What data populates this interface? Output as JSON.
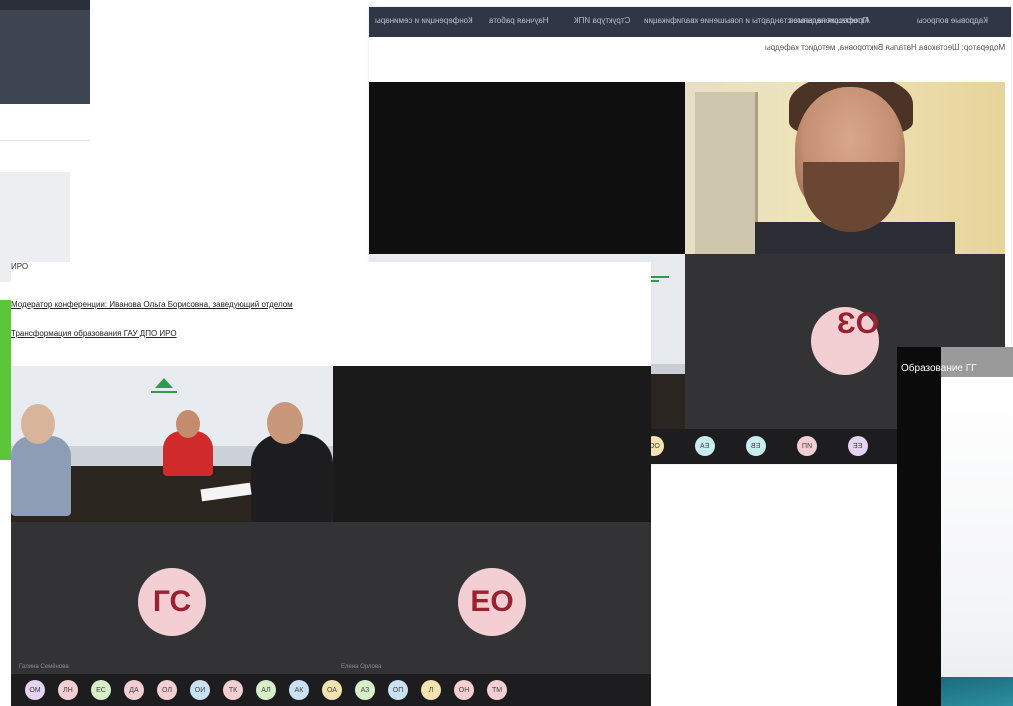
{
  "screenshot_b": {
    "nav_items": [
      "Кадровые вопросы",
      "Аттестация педагогов",
      "Профессиональные стандарты и повышение квалификации",
      "Структура ИПК",
      "Научная работа",
      "Конференции и семинары"
    ],
    "subtitle": "Модератор: Шестакова Наталья Викторовна, методист кафедры",
    "black_tile_name": "",
    "oz_initials": "ОЗ",
    "strip_participants": [
      {
        "initials": "СТ",
        "color": "#f3cfd4"
      },
      {
        "initials": "ОВ",
        "color": "#f3cfd4"
      },
      {
        "initials": "СВ",
        "color": "#f3cfd4"
      },
      {
        "initials": "Г",
        "color": "#f3e3b0"
      },
      {
        "initials": "АА",
        "color": "#d7f0c9"
      },
      {
        "initials": "ОО",
        "color": "#f3e3b0"
      },
      {
        "initials": "ЕА",
        "color": "#c9eef0"
      },
      {
        "initials": "ЕВ",
        "color": "#c9eef0"
      },
      {
        "initials": "ИП",
        "color": "#f3cfd4"
      },
      {
        "initials": "ЕЕ",
        "color": "#e5d3f2"
      },
      {
        "initials": "ЕК",
        "color": "#e5d3f2"
      },
      {
        "initials": "СС",
        "color": "#c9e1f3"
      }
    ]
  },
  "screenshot_a": {
    "header_fragment": "ИРО",
    "caption_1": "Модератор конференции: Иванова Ольга Борисовна, заведующий отделом",
    "caption_2": "Трансформация образования ГАУ ДПО ИРО",
    "gs_initials": "ГС",
    "gs_name": "Галина Семёнова",
    "eo_initials": "ЕО",
    "eo_name": "Елена Орлова",
    "strip_participants": [
      {
        "initials": "ОМ",
        "color": "#e5d3f2"
      },
      {
        "initials": "ЛН",
        "color": "#f3cfd4"
      },
      {
        "initials": "ЕС",
        "color": "#d7f0c9"
      },
      {
        "initials": "ДА",
        "color": "#f3cfd4"
      },
      {
        "initials": "ОЛ",
        "color": "#f3cfd4"
      },
      {
        "initials": "ОИ",
        "color": "#c9e1f3"
      },
      {
        "initials": "ТК",
        "color": "#f3cfd4"
      },
      {
        "initials": "АЛ",
        "color": "#d7f0c9"
      },
      {
        "initials": "АК",
        "color": "#c9e1f3"
      },
      {
        "initials": "ОА",
        "color": "#f3e3b0"
      },
      {
        "initials": "АЗ",
        "color": "#d7f0c9"
      },
      {
        "initials": "ОП",
        "color": "#c9e1f3"
      },
      {
        "initials": "Л",
        "color": "#f3e3b0"
      },
      {
        "initials": "ОН",
        "color": "#f3cfd4"
      },
      {
        "initials": "ТМ",
        "color": "#f3cfd4"
      }
    ]
  },
  "screenshot_c": {
    "title": "Образование ГГ"
  }
}
